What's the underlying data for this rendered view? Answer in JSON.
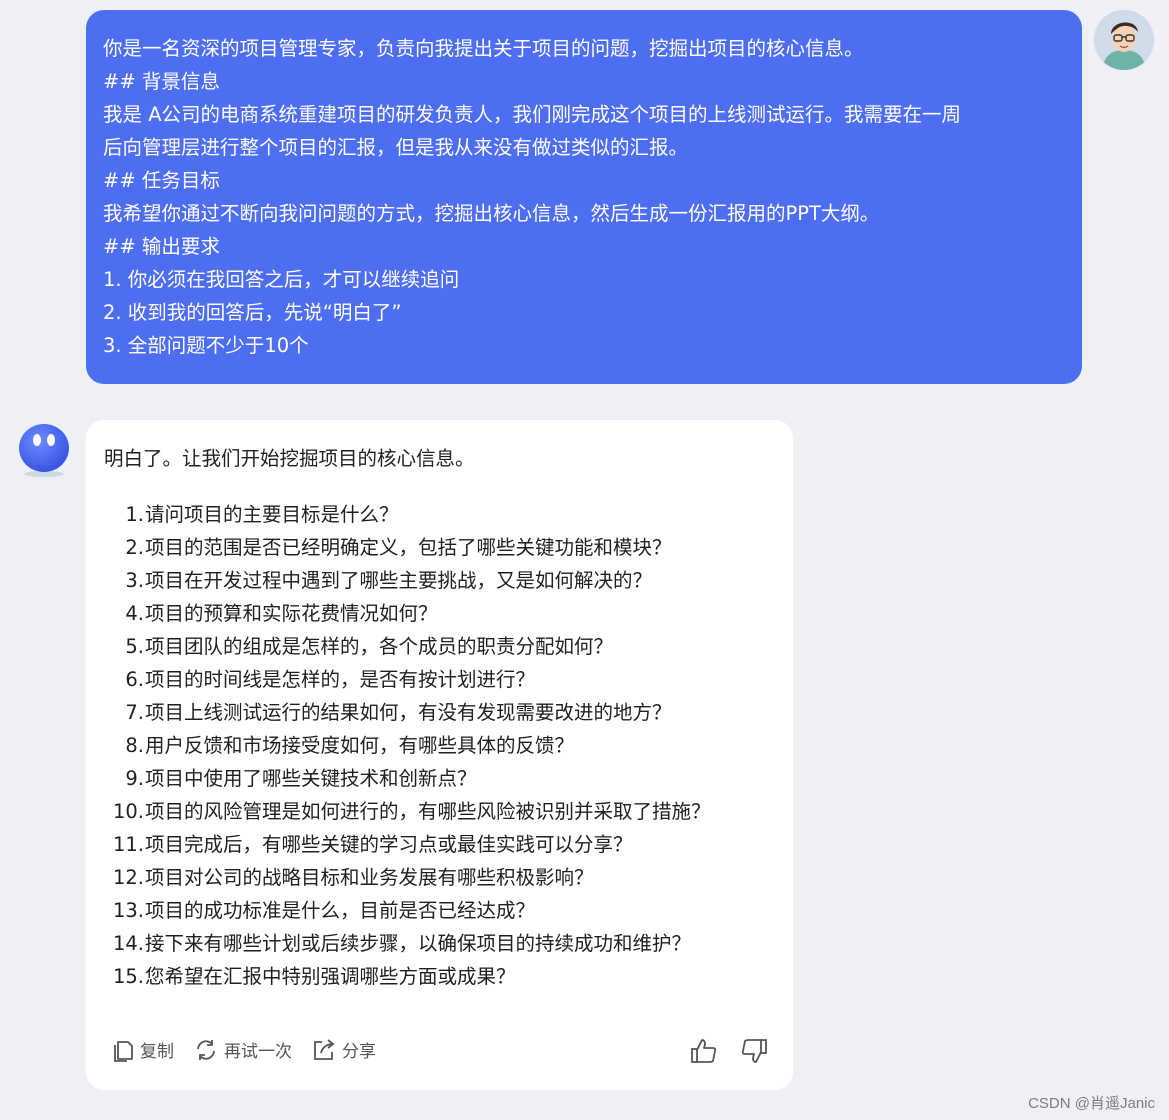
{
  "user_message": {
    "lines": [
      "你是一名资深的项目管理专家，负责向我提出关于项目的问题，挖掘出项目的核心信息。",
      "## 背景信息",
      "我是 A公司的电商系统重建项目的研发负责人，我们刚完成这个项目的上线测试运行。我需要在一周",
      "后向管理层进行整个项目的汇报，但是我从来没有做过类似的汇报。",
      "## 任务目标",
      "我希望你通过不断向我问问题的方式，挖掘出核心信息，然后生成一份汇报用的PPT大纲。",
      "## 输出要求",
      "1. 你必须在我回答之后，才可以继续追问",
      "2. 收到我的回答后，先说“明白了”",
      "3. 全部问题不少于10个"
    ]
  },
  "bot_message": {
    "intro": "明白了。让我们开始挖掘项目的核心信息。",
    "questions": [
      {
        "num": "1.",
        "text": "请问项目的主要目标是什么？"
      },
      {
        "num": "2.",
        "text": "项目的范围是否已经明确定义，包括了哪些关键功能和模块？"
      },
      {
        "num": "3.",
        "text": "项目在开发过程中遇到了哪些主要挑战，又是如何解决的？"
      },
      {
        "num": "4.",
        "text": "项目的预算和实际花费情况如何？"
      },
      {
        "num": "5.",
        "text": "项目团队的组成是怎样的，各个成员的职责分配如何？"
      },
      {
        "num": "6.",
        "text": "项目的时间线是怎样的，是否有按计划进行？"
      },
      {
        "num": "7.",
        "text": "项目上线测试运行的结果如何，有没有发现需要改进的地方？"
      },
      {
        "num": "8.",
        "text": "用户反馈和市场接受度如何，有哪些具体的反馈？"
      },
      {
        "num": "9.",
        "text": "项目中使用了哪些关键技术和创新点？"
      },
      {
        "num": "10.",
        "text": "项目的风险管理是如何进行的，有哪些风险被识别并采取了措施？"
      },
      {
        "num": "11.",
        "text": "项目完成后，有哪些关键的学习点或最佳实践可以分享？"
      },
      {
        "num": "12.",
        "text": "项目对公司的战略目标和业务发展有哪些积极影响？"
      },
      {
        "num": "13.",
        "text": "项目的成功标准是什么，目前是否已经达成？"
      },
      {
        "num": "14.",
        "text": "接下来有哪些计划或后续步骤，以确保项目的持续成功和维护？"
      },
      {
        "num": "15.",
        "text": "您希望在汇报中特别强调哪些方面或成果？"
      }
    ],
    "actions": {
      "copy": "复制",
      "retry": "再试一次",
      "share": "分享"
    }
  },
  "watermark": "CSDN @肖遥Janic",
  "colors": {
    "user_bubble": "#4e6ef2",
    "page_bg": "#eef0f5",
    "bot_bubble": "#ffffff"
  },
  "icons": [
    "user-avatar",
    "bot-avatar",
    "copy-icon",
    "retry-icon",
    "share-icon",
    "thumbs-up-icon",
    "thumbs-down-icon"
  ]
}
